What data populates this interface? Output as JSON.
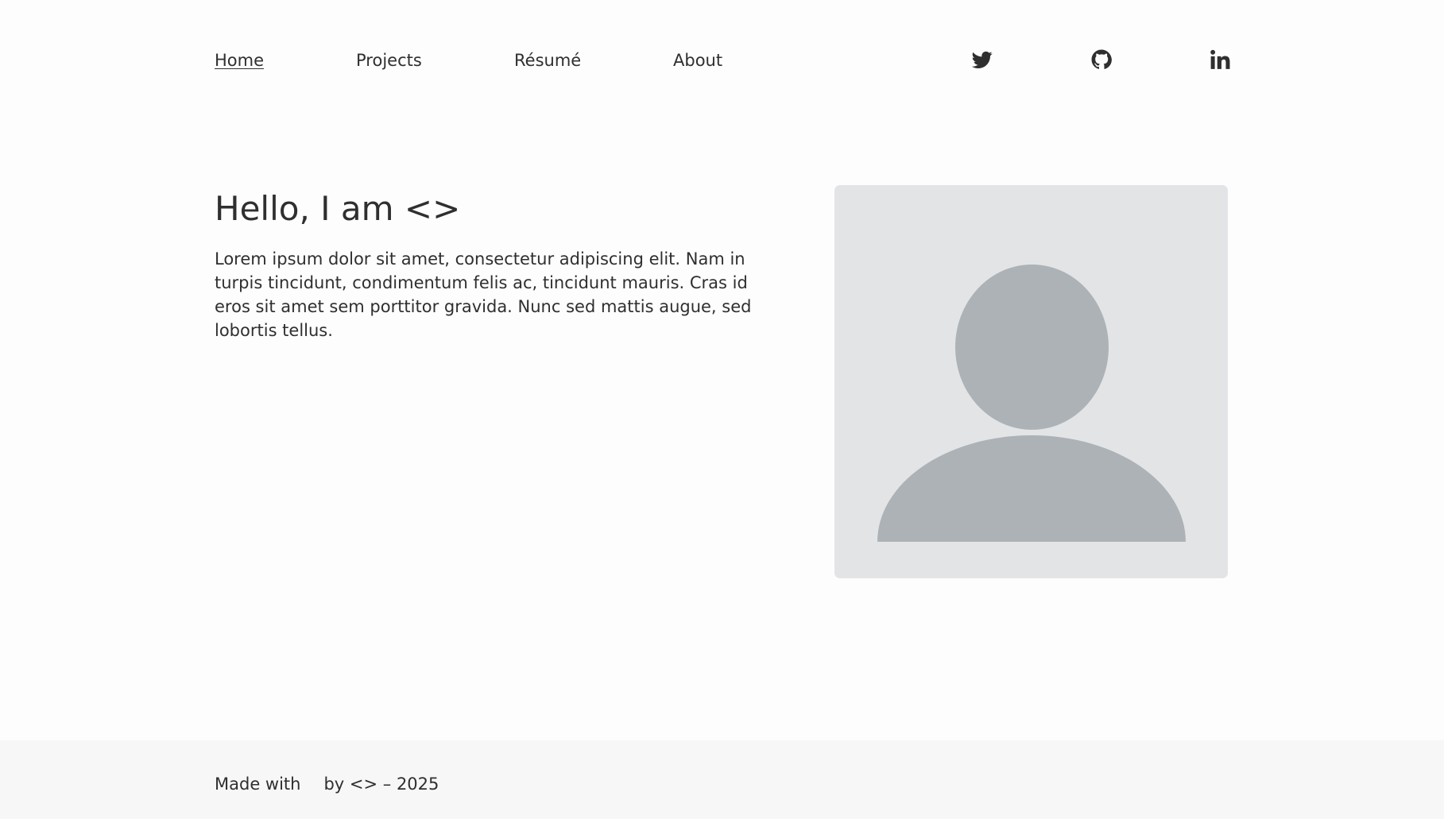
{
  "nav": {
    "home": "Home",
    "projects": "Projects",
    "resume": "Résumé",
    "about": "About"
  },
  "social": {
    "icons": [
      "twitter-icon",
      "github-icon",
      "linkedin-icon"
    ]
  },
  "hero": {
    "title": "Hello, I am <>",
    "text": "Lorem ipsum dolor sit amet, consectetur adipiscing elit. Nam in turpis tincidunt, condimentum felis ac, tincidunt mauris. Cras id eros sit amet sem porttitor gravida. Nunc sed mattis augue, sed lobortis tellus."
  },
  "avatar": {
    "icon": "user-placeholder-icon",
    "background": "#e3e4e6",
    "silhouette": "#adb2b6"
  },
  "footer": {
    "made_with": "Made with",
    "by": "by <> – 2025",
    "heart_color": "#f47c7c"
  },
  "colors": {
    "text": "#2f2f2f",
    "footer_bg": "#f7f7f7"
  }
}
